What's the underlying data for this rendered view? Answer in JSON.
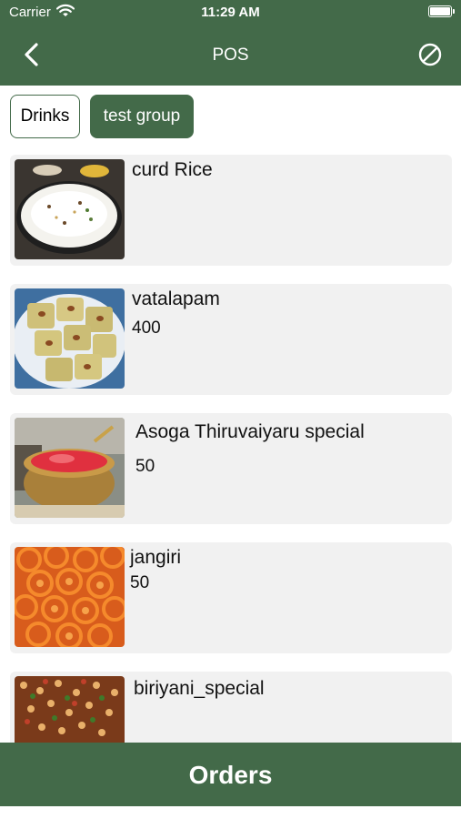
{
  "status_bar": {
    "carrier": "Carrier",
    "time": "11:29 AM"
  },
  "nav": {
    "title": "POS"
  },
  "groups": [
    {
      "label": "Drinks",
      "selected": false
    },
    {
      "label": "test group",
      "selected": true
    }
  ],
  "items": [
    {
      "name": "curd Rice",
      "price": ""
    },
    {
      "name": "vatalapam",
      "price": "400"
    },
    {
      "name": "Asoga Thiruvaiyaru special",
      "price": "50"
    },
    {
      "name": "jangiri",
      "price": "50"
    },
    {
      "name": "biriyani_special",
      "price": ""
    }
  ],
  "footer": {
    "orders_label": "Orders"
  },
  "colors": {
    "primary": "#436a49",
    "card": "#f1f1f1"
  }
}
